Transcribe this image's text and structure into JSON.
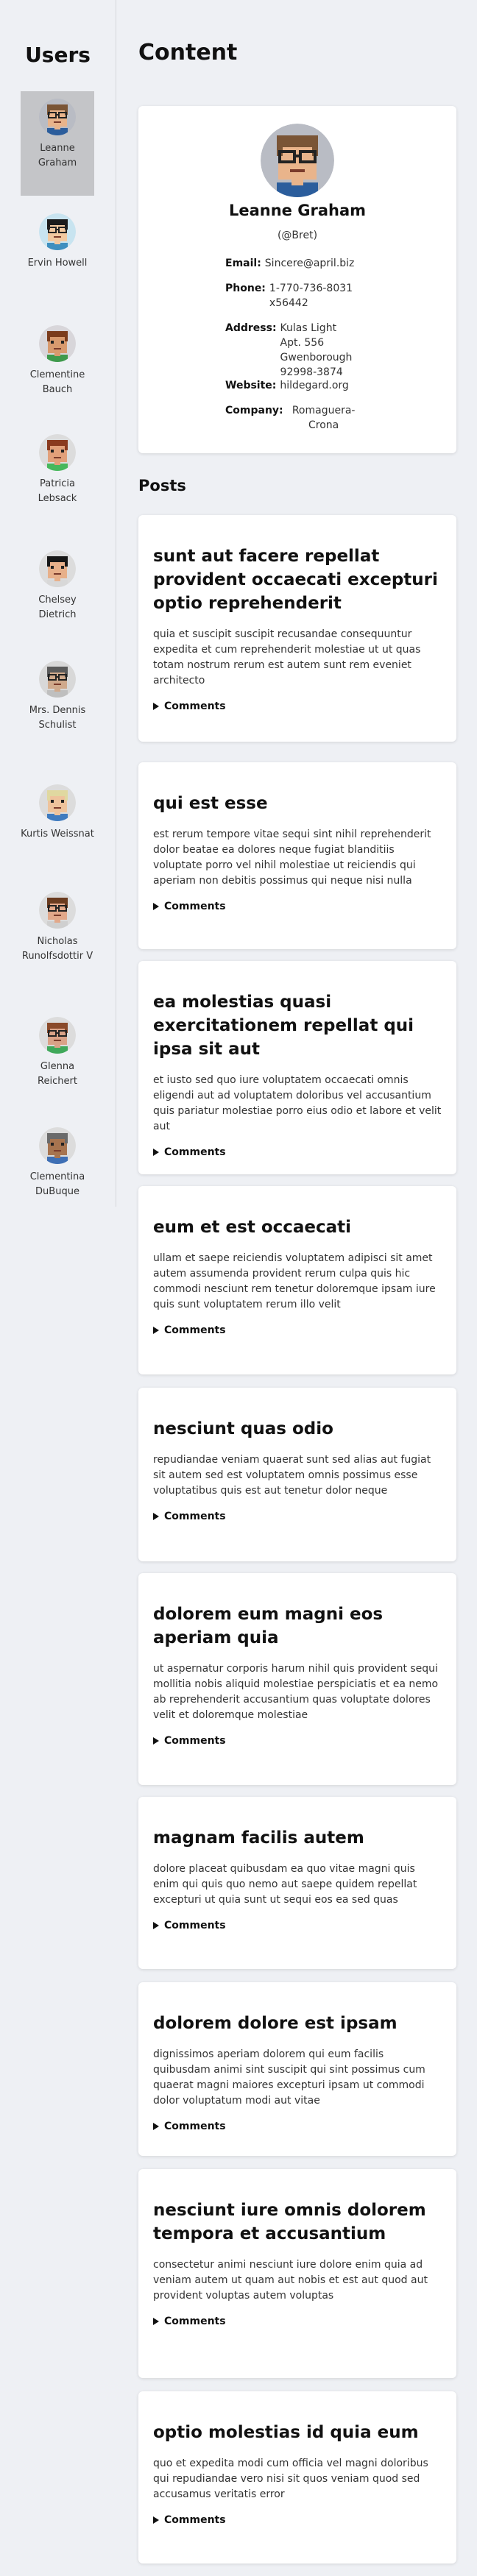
{
  "sidebar": {
    "title": "Users",
    "users": [
      {
        "name": "Leanne Graham",
        "avatar_bg": "#b9bcc4",
        "skin": "#e9b48b",
        "hair": "#7a5536",
        "shirt": "#2b5d9c",
        "glasses": true
      },
      {
        "name": "Ervin Howell",
        "avatar_bg": "#c8e4f0",
        "skin": "#f2c9a0",
        "hair": "#1b1b1b",
        "shirt": "#3e8fbf",
        "glasses": true
      },
      {
        "name": "Clementine Bauch",
        "avatar_bg": "#d8d6da",
        "skin": "#d89a6e",
        "hair": "#7b3c1c",
        "shirt": "#3f9a4c",
        "glasses": false
      },
      {
        "name": "Patricia Lebsack",
        "avatar_bg": "#dcdcdc",
        "skin": "#e2a07a",
        "hair": "#8a3a1e",
        "shirt": "#46b85c",
        "glasses": false
      },
      {
        "name": "Chelsey Dietrich",
        "avatar_bg": "#dcdcdc",
        "skin": "#e7b08a",
        "hair": "#161616",
        "shirt": "#d8d8d8",
        "glasses": false
      },
      {
        "name": "Mrs. Dennis Schulist",
        "avatar_bg": "#d8d8d8",
        "skin": "#cfa98c",
        "hair": "#5a5a5a",
        "shirt": "#bfbfbf",
        "glasses": true
      },
      {
        "name": "Kurtis Weissnat",
        "avatar_bg": "#dcdcdc",
        "skin": "#eec39c",
        "hair": "#e0d8a0",
        "shirt": "#3f7bbf",
        "glasses": false
      },
      {
        "name": "Nicholas Runolfsdottir V",
        "avatar_bg": "#dcdcdc",
        "skin": "#e2a88a",
        "hair": "#6a3b1f",
        "shirt": "#cfcfcf",
        "glasses": true
      },
      {
        "name": "Glenna Reichert",
        "avatar_bg": "#dcdcdc",
        "skin": "#d9a287",
        "hair": "#8a4a2a",
        "shirt": "#3fa85a",
        "glasses": true
      },
      {
        "name": "Clementina DuBuque",
        "avatar_bg": "#dcdcdc",
        "skin": "#a7744f",
        "hair": "#6a6a6a",
        "shirt": "#3e6fb5",
        "glasses": false
      }
    ]
  },
  "main": {
    "title": "Content",
    "profile": {
      "name": "Leanne Graham",
      "username": "(@Bret)",
      "email_label": "Email:",
      "email": "Sincere@april.biz",
      "phone_label": "Phone:",
      "phone": "1-770-736-8031 x56442",
      "address_label": "Address:",
      "address": "Kulas Light Apt. 556 Gwenborough 92998-3874",
      "website_label": "Website:",
      "website": "hildegard.org",
      "company_label": "Company:",
      "company": "Romaguera-Crona"
    },
    "posts_title": "Posts",
    "comments_label": "Comments",
    "posts": [
      {
        "title": "sunt aut facere repellat provident occaecati excepturi optio reprehenderit",
        "body": "quia et suscipit suscipit recusandae consequuntur expedita et cum reprehenderit molestiae ut ut quas totam nostrum rerum est autem sunt rem eveniet architecto"
      },
      {
        "title": "qui est esse",
        "body": "est rerum tempore vitae sequi sint nihil reprehenderit dolor beatae ea dolores neque fugiat blanditiis voluptate porro vel nihil molestiae ut reiciendis qui aperiam non debitis possimus qui neque nisi nulla"
      },
      {
        "title": "ea molestias quasi exercitationem repellat qui ipsa sit aut",
        "body": "et iusto sed quo iure voluptatem occaecati omnis eligendi aut ad voluptatem doloribus vel accusantium quis pariatur molestiae porro eius odio et labore et velit aut"
      },
      {
        "title": "eum et est occaecati",
        "body": "ullam et saepe reiciendis voluptatem adipisci sit amet autem assumenda provident rerum culpa quis hic commodi nesciunt rem tenetur doloremque ipsam iure quis sunt voluptatem rerum illo velit"
      },
      {
        "title": "nesciunt quas odio",
        "body": "repudiandae veniam quaerat sunt sed alias aut fugiat sit autem sed est voluptatem omnis possimus esse voluptatibus quis est aut tenetur dolor neque"
      },
      {
        "title": "dolorem eum magni eos aperiam quia",
        "body": "ut aspernatur corporis harum nihil quis provident sequi mollitia nobis aliquid molestiae perspiciatis et ea nemo ab reprehenderit accusantium quas voluptate dolores velit et doloremque molestiae"
      },
      {
        "title": "magnam facilis autem",
        "body": "dolore placeat quibusdam ea quo vitae magni quis enim qui quis quo nemo aut saepe quidem repellat excepturi ut quia sunt ut sequi eos ea sed quas"
      },
      {
        "title": "dolorem dolore est ipsam",
        "body": "dignissimos aperiam dolorem qui eum facilis quibusdam animi sint suscipit qui sint possimus cum quaerat magni maiores excepturi ipsam ut commodi dolor voluptatum modi aut vitae"
      },
      {
        "title": "nesciunt iure omnis dolorem tempora et accusantium",
        "body": "consectetur animi nesciunt iure dolore enim quia ad veniam autem ut quam aut nobis et est aut quod aut provident voluptas autem voluptas"
      },
      {
        "title": "optio molestias id quia eum",
        "body": "quo et expedita modi cum officia vel magni doloribus qui repudiandae vero nisi sit quos veniam quod sed accusamus veritatis error"
      }
    ]
  }
}
